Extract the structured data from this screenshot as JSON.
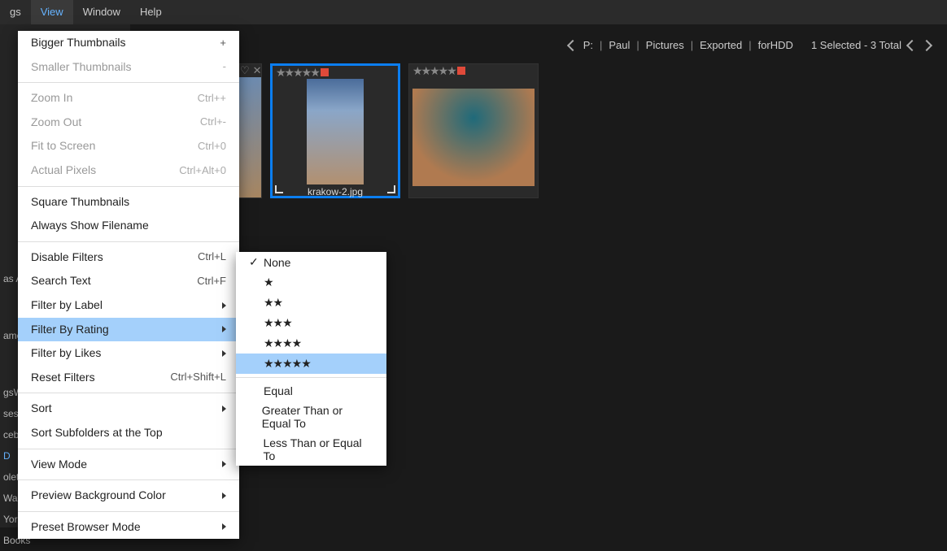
{
  "menubar": {
    "items": [
      "gs",
      "View",
      "Window",
      "Help"
    ],
    "active_index": 1
  },
  "path": {
    "segments": [
      "P:",
      "Paul",
      "Pictures",
      "Exported",
      "forHDD"
    ],
    "status": "1 Selected - 3 Total"
  },
  "sidebar": {
    "items": [
      "as A",
      "ame",
      "gsW",
      "ses",
      "cebc",
      "D",
      "olet",
      "Wallpapers",
      "York",
      "Books"
    ],
    "active_index": 5
  },
  "view_menu": {
    "groups": [
      [
        {
          "label": "Bigger Thumbnails",
          "shortcut": "+",
          "enabled": true
        },
        {
          "label": "Smaller Thumbnails",
          "shortcut": "-",
          "enabled": false
        }
      ],
      [
        {
          "label": "Zoom In",
          "shortcut": "Ctrl++",
          "enabled": false
        },
        {
          "label": "Zoom Out",
          "shortcut": "Ctrl+-",
          "enabled": false
        },
        {
          "label": "Fit to Screen",
          "shortcut": "Ctrl+0",
          "enabled": false
        },
        {
          "label": "Actual Pixels",
          "shortcut": "Ctrl+Alt+0",
          "enabled": false
        }
      ],
      [
        {
          "label": "Square Thumbnails",
          "shortcut": "",
          "enabled": true
        },
        {
          "label": "Always Show Filename",
          "shortcut": "",
          "enabled": true
        }
      ],
      [
        {
          "label": "Disable Filters",
          "shortcut": "Ctrl+L",
          "enabled": true
        },
        {
          "label": "Search Text",
          "shortcut": "Ctrl+F",
          "enabled": true
        },
        {
          "label": "Filter by Label",
          "shortcut": "",
          "enabled": true,
          "submenu": true
        },
        {
          "label": "Filter By Rating",
          "shortcut": "",
          "enabled": true,
          "submenu": true,
          "highlighted": true
        },
        {
          "label": "Filter by Likes",
          "shortcut": "",
          "enabled": true,
          "submenu": true
        },
        {
          "label": "Reset Filters",
          "shortcut": "Ctrl+Shift+L",
          "enabled": true
        }
      ],
      [
        {
          "label": "Sort",
          "shortcut": "",
          "enabled": true,
          "submenu": true
        },
        {
          "label": "Sort Subfolders at the Top",
          "shortcut": "",
          "enabled": true
        }
      ],
      [
        {
          "label": "View Mode",
          "shortcut": "",
          "enabled": true,
          "submenu": true
        }
      ],
      [
        {
          "label": "Preview Background Color",
          "shortcut": "",
          "enabled": true,
          "submenu": true
        }
      ],
      [
        {
          "label": "Preset Browser Mode",
          "shortcut": "",
          "enabled": true,
          "submenu": true
        }
      ]
    ]
  },
  "rating_submenu": {
    "items": [
      {
        "label": "None",
        "checked": true
      },
      {
        "label": "★"
      },
      {
        "label": "★★"
      },
      {
        "label": "★★★"
      },
      {
        "label": "★★★★"
      },
      {
        "label": "★★★★★",
        "highlighted": true
      },
      {
        "sep": true
      },
      {
        "label": "Equal"
      },
      {
        "label": "Greater Than or Equal To"
      },
      {
        "label": "Less Than or Equal To"
      }
    ]
  },
  "thumbnails": {
    "selected_filename": "krakow-2.jpg",
    "star_display": "★★★★★"
  }
}
